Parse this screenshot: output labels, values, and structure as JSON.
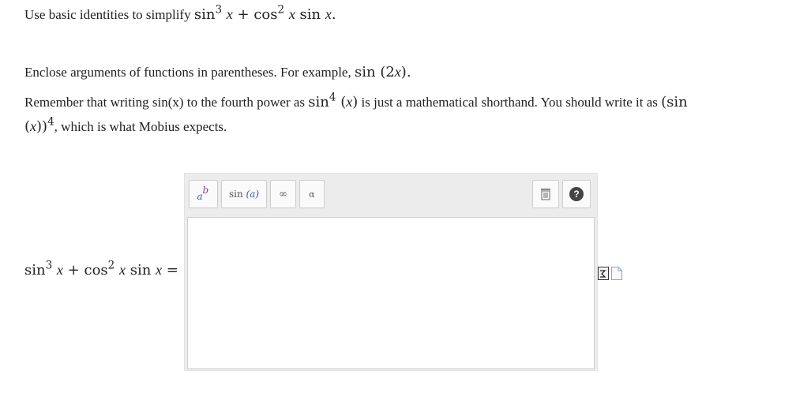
{
  "question": {
    "prefix": "Use basic identities to simplify",
    "expr_a": "sin",
    "exp_a": "3",
    "var_a": "x",
    "plus": "+",
    "expr_b": "cos",
    "exp_b": "2",
    "var_b": "x",
    "expr_c": "sin",
    "var_c": "x",
    "end": "."
  },
  "instructions": {
    "enclose_text": "Enclose arguments of functions in parentheses. For example,",
    "enclose_example_fn": "sin",
    "enclose_example_arg": "(2",
    "enclose_example_var": "x",
    "enclose_example_close": ").",
    "remember_1": "Remember that writing sin(x) to the fourth power as",
    "remember_fn": "sin",
    "remember_exp": "4",
    "remember_arg_open": "(",
    "remember_arg_var": "x",
    "remember_arg_close": ")",
    "remember_2": "is just a mathematical shorthand. You should write it as",
    "remember_paren_open": "(sin (",
    "remember_paren_var": "x",
    "remember_paren_close": "))",
    "remember_paren_exp": "4",
    "remember_3": ", which is what Mobius expects."
  },
  "answer": {
    "lhs_fn_a": "sin",
    "lhs_exp_a": "3",
    "lhs_var_a": "x",
    "lhs_plus": "+",
    "lhs_fn_b": "cos",
    "lhs_exp_b": "2",
    "lhs_var_b": "x",
    "lhs_fn_c": "sin",
    "lhs_var_c": "x",
    "lhs_eq": "=",
    "input_value": ""
  },
  "toolbar": {
    "power_base": "a",
    "power_exp": "b",
    "function_label": "sin",
    "function_arg": "(a)",
    "infinity_label": "∞",
    "greek_label": "α",
    "trash_icon": "trash-icon",
    "help_label": "?"
  },
  "colors": {
    "toolbar_bg": "#ececec",
    "help_bg": "#444444",
    "power_exp": "#7a3fa0",
    "power_base": "#3b5aa6"
  }
}
